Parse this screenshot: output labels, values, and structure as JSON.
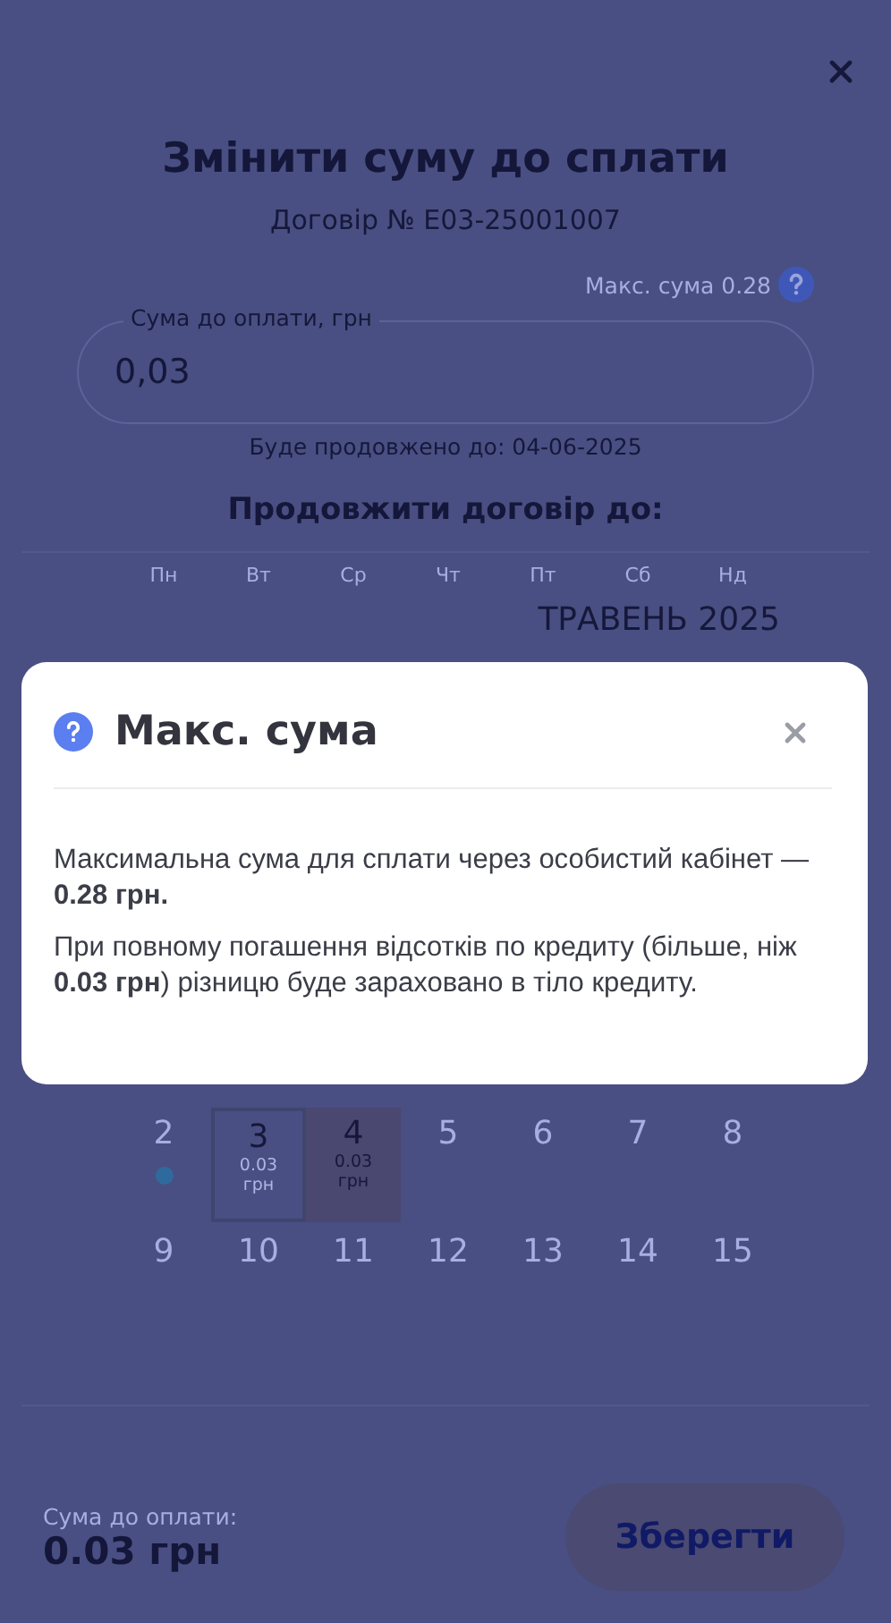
{
  "page": {
    "title": "Змінити суму до сплати",
    "contract": "Договір № Е03-25001007",
    "max_hint": "Макс. сума 0.28",
    "amount_field": {
      "label": "Сума до оплати, грн",
      "value": "0,03"
    },
    "extended_until": "Буде продовжено до: 04-06-2025",
    "calendar_heading": "Продовжити договір до:",
    "weekdays": [
      "Пн",
      "Вт",
      "Ср",
      "Чт",
      "Пт",
      "Сб",
      "Нд"
    ],
    "month": "ТРАВЕНЬ 2025",
    "weeks": [
      [
        {
          "day": "2",
          "selected": false,
          "outlined": false,
          "dot": true
        },
        {
          "day": "3",
          "sub": "0.03 грн",
          "selected": false,
          "outlined": true,
          "dot": false
        },
        {
          "day": "4",
          "sub": "0.03 грн",
          "selected": true,
          "outlined": false,
          "dot": false
        },
        {
          "day": "5",
          "selected": false,
          "outlined": false,
          "dot": false
        },
        {
          "day": "6",
          "selected": false,
          "outlined": false,
          "dot": false
        },
        {
          "day": "7",
          "selected": false,
          "outlined": false,
          "dot": false
        },
        {
          "day": "8",
          "selected": false,
          "outlined": false,
          "dot": false
        }
      ],
      [
        {
          "day": "9",
          "selected": false,
          "outlined": false,
          "dot": false
        },
        {
          "day": "10",
          "selected": false,
          "outlined": false,
          "dot": false
        },
        {
          "day": "11",
          "selected": false,
          "outlined": false,
          "dot": false
        },
        {
          "day": "12",
          "selected": false,
          "outlined": false,
          "dot": false
        },
        {
          "day": "13",
          "selected": false,
          "outlined": false,
          "dot": false
        },
        {
          "day": "14",
          "selected": false,
          "outlined": false,
          "dot": false
        },
        {
          "day": "15",
          "selected": false,
          "outlined": false,
          "dot": false
        }
      ]
    ],
    "footer": {
      "label": "Сума до оплати:",
      "total": "0.03 грн",
      "button": "Зберегти"
    }
  },
  "dialog": {
    "title": "Макс. сума",
    "paragraphs": [
      "Максимальна сума для сплати через особистий кабінет — **0.28 грн.**",
      "При повному погашення відсотків по кредиту (більше, ніж **0.03 грн**) різницю буде зараховано в тіло кредиту."
    ]
  }
}
